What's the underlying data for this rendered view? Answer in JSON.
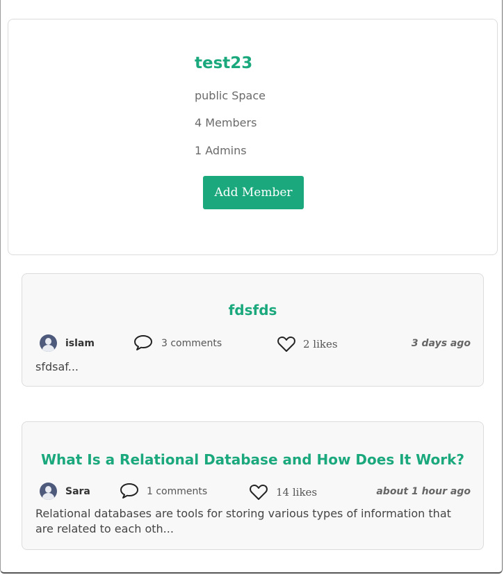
{
  "space": {
    "title": "test23",
    "visibility": "public Space",
    "members": "4 Members",
    "admins": "1 Admins",
    "add_member_label": "Add Member"
  },
  "posts": [
    {
      "title": "fdsfds",
      "author": "islam",
      "comments": "3 comments",
      "likes": "2 likes",
      "time": "3 days ago",
      "excerpt": "sfdsaf..."
    },
    {
      "title": "What Is a Relational Database and How Does It Work?",
      "author": "Sara",
      "comments": "1 comments",
      "likes": "14 likes",
      "time": "about 1 hour ago",
      "excerpt": "Relational databases are tools for storing various types of information that are related to each oth..."
    }
  ],
  "icons": {
    "avatar": "user-avatar-icon",
    "comment": "speech-bubble-icon",
    "like": "heart-icon"
  },
  "colors": {
    "accent": "#1aa87c",
    "card_border": "#dcdcdc",
    "post_background": "#f8f8f8"
  }
}
